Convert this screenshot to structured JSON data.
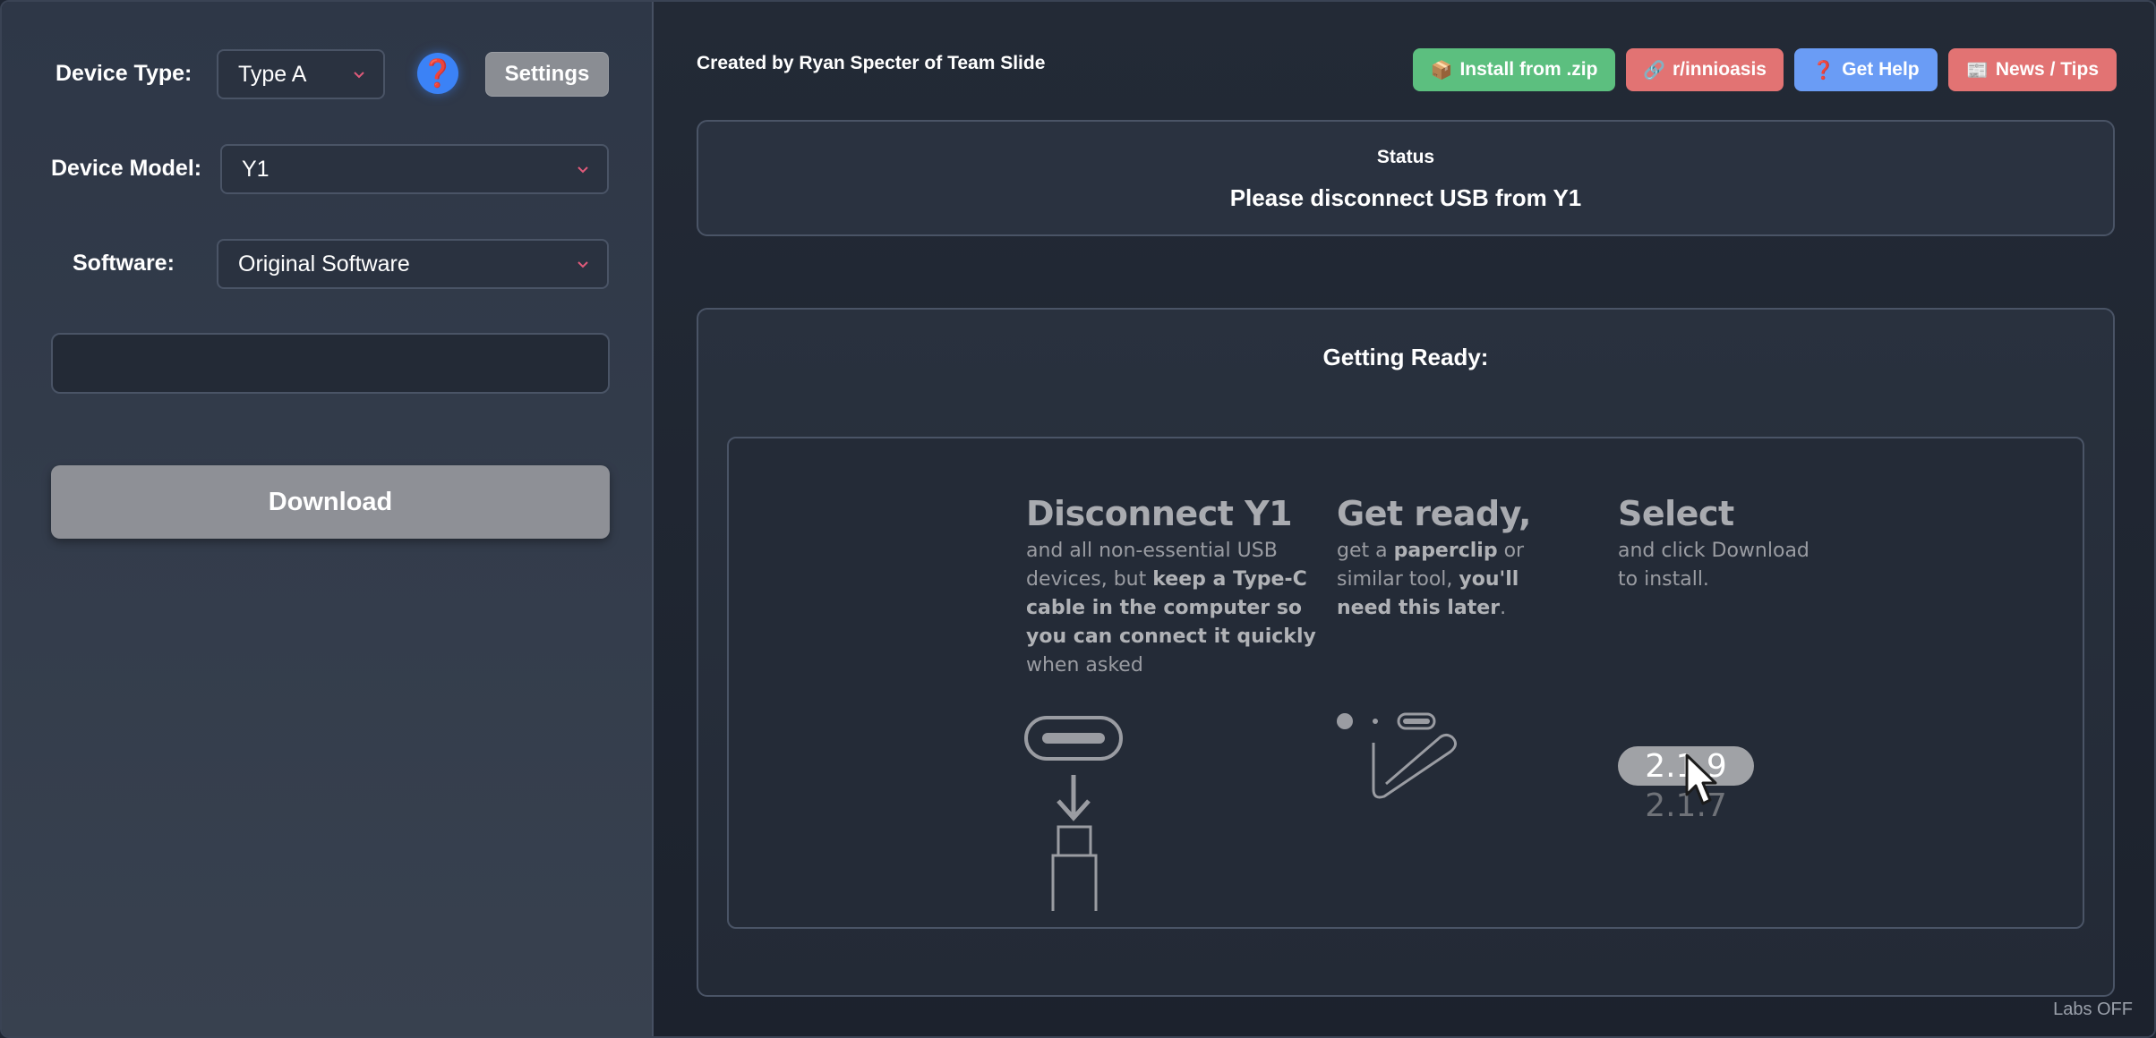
{
  "sidebar": {
    "device_type_label": "Device Type:",
    "device_type_value": "Type A",
    "help_glyph": "❓",
    "settings_label": "Settings",
    "device_model_label": "Device Model:",
    "device_model_value": "Y1",
    "software_label": "Software:",
    "software_value": "Original Software",
    "download_label": "Download"
  },
  "header": {
    "credit": "Created by Ryan Specter of Team Slide",
    "buttons": [
      {
        "icon": "📦",
        "label": "Install from .zip",
        "color": "#5cbf7f"
      },
      {
        "icon": "🔗",
        "label": "r/innioasis",
        "color": "#e27373"
      },
      {
        "icon": "❓",
        "label": "Get Help",
        "color": "#6a9cf5"
      },
      {
        "icon": "📰",
        "label": "News / Tips",
        "color": "#e27373"
      }
    ]
  },
  "status": {
    "title": "Status",
    "text": "Please disconnect USB from Y1"
  },
  "getting_ready": {
    "title": "Getting Ready:",
    "steps": [
      {
        "heading": "Disconnect Y1",
        "text_1": "and all non-essential USB devices, but ",
        "bold_1": "keep a Type-C cable in the computer so you can connect it quickly",
        "text_2": " when asked"
      },
      {
        "heading": "Get ready,",
        "text_1": "get a ",
        "bold_1": "paperclip",
        "text_2": " or similar tool, ",
        "bold_2": "you'll need this later",
        "text_3": "."
      },
      {
        "heading": "Select",
        "text_1": "and click Download to install.",
        "version_selected": "2.1.9",
        "version_other": "2.1.7"
      }
    ]
  },
  "labs_status": "Labs OFF"
}
